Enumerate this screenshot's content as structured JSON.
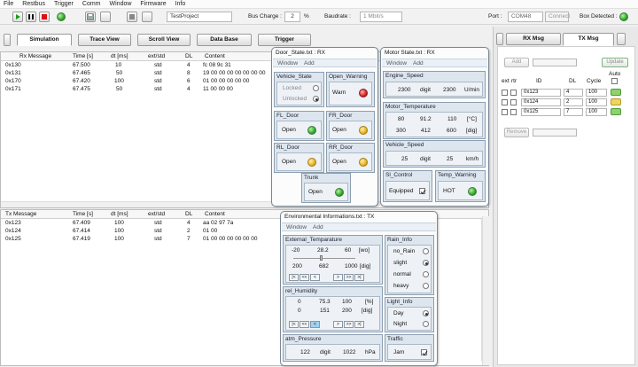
{
  "menu": [
    "File",
    "Restbus",
    "Trigger",
    "Comm",
    "Window",
    "Firmware",
    "Info"
  ],
  "toolbar": {
    "project": "TestProject",
    "bus_charge_label": "Bus Charge :",
    "bus_charge_value": "2",
    "bus_charge_unit": "%",
    "baudrate_label": "Baudrate :",
    "baudrate_value": "1 Mbit/s",
    "port_label": "Port :",
    "port_value": "COM48",
    "connect_label": "Connect",
    "box_detected_label": "Box Detected :"
  },
  "tabs": [
    "Simulation",
    "Trace View",
    "Scroll View",
    "Data Base",
    "Trigger"
  ],
  "rx_table": {
    "headers": [
      "Rx Message",
      "Time [s]",
      "dt [ms]",
      "ext/std",
      "DL",
      "Content"
    ],
    "rows": [
      [
        "0x130",
        "67.500",
        "10",
        "std",
        "4",
        "fc 08 9c 31"
      ],
      [
        "0x131",
        "67.465",
        "50",
        "std",
        "8",
        "19 00 00 00 00 00 00 00"
      ],
      [
        "0x170",
        "67.420",
        "100",
        "std",
        "6",
        "01 00 00 00 00 00"
      ],
      [
        "0x171",
        "67.475",
        "50",
        "std",
        "4",
        "11 00 00 00"
      ]
    ]
  },
  "tx_table": {
    "headers": [
      "Tx Message",
      "Time [s]",
      "dt [ms]",
      "ext/std",
      "DL",
      "Content"
    ],
    "rows": [
      [
        "0x123",
        "67.409",
        "100",
        "std",
        "4",
        "aa 02 97 7a"
      ],
      [
        "0x124",
        "67.414",
        "100",
        "std",
        "2",
        "01 00"
      ],
      [
        "0x125",
        "67.419",
        "100",
        "std",
        "7",
        "01 00 00 00 00 00 00"
      ]
    ]
  },
  "door_window": {
    "title": "Door_State.txt : RX",
    "menu": [
      "Window",
      "Add"
    ],
    "vehicle_state": {
      "title": "Vehicle_State",
      "opt1": "Locked",
      "opt2": "Unlocked"
    },
    "open_warning": {
      "title": "Open_Warning",
      "label": "Warn"
    },
    "fl": {
      "title": "FL_Door",
      "label": "Open"
    },
    "fr": {
      "title": "FR_Door",
      "label": "Open"
    },
    "rl": {
      "title": "RL_Door",
      "label": "Open"
    },
    "rr": {
      "title": "RR_Door",
      "label": "Open"
    },
    "trunk": {
      "title": "Trunk",
      "label": "Open"
    }
  },
  "motor_window": {
    "title": "Motor State.txt : RX",
    "menu": [
      "Window",
      "Add"
    ],
    "engine_speed": {
      "title": "Engine_Speed",
      "v1": "2300",
      "u1": "digit",
      "v2": "2300",
      "u2": "U/min"
    },
    "motor_temp": {
      "title": "Motor_Temperature",
      "r1": [
        "80",
        "91.2",
        "110",
        "[°C]"
      ],
      "r2": [
        "300",
        "412",
        "600",
        "[dig]"
      ]
    },
    "vehicle_speed": {
      "title": "Vehicle_Speed",
      "v1": "25",
      "u1": "digit",
      "v2": "25",
      "u2": "km/h"
    },
    "sl_control": {
      "title": "Sl_Control",
      "label": "Equipped"
    },
    "temp_warning": {
      "title": "Temp_Warning",
      "label": "HOT"
    }
  },
  "env_window": {
    "title": "Environmental Informations.txt : TX",
    "menu": [
      "Window",
      "Add"
    ],
    "ext_temp": {
      "title": "External_Temparature",
      "r1": [
        "-20",
        "28.2",
        "60",
        "[wo]"
      ],
      "r2": [
        "200",
        "682",
        "1000",
        "[dig]"
      ]
    },
    "humidity": {
      "title": "rel_Humidity",
      "r1": [
        "0",
        "75.3",
        "100",
        "[%]"
      ],
      "r2": [
        "0",
        "151",
        "200",
        "[dig]"
      ]
    },
    "pressure": {
      "title": "atm_Pressure",
      "v1": "122",
      "u1": "digit",
      "v2": "1022",
      "u2": "hPa"
    },
    "rain": {
      "title": "Rain_Info",
      "opts": [
        "no_Rain",
        "slight",
        "normal",
        "heavy"
      ],
      "selected": 1
    },
    "light": {
      "title": "Light_Info",
      "opts": [
        "Day",
        "Night"
      ],
      "selected": 0
    },
    "traffic": {
      "title": "Traffic",
      "label": "Jam"
    },
    "nav": [
      "|<",
      "<<",
      "<",
      ">",
      ">>",
      ">|"
    ]
  },
  "right_panel": {
    "tabs": [
      "RX Msg",
      "TX Msg"
    ],
    "add_label": "Add",
    "update_label": "Update",
    "remove_label": "Remove",
    "headers": [
      "ext",
      "rtr",
      "ID",
      "DL",
      "Cycle",
      "Auto"
    ],
    "rows": [
      {
        "id": "0x123",
        "dl": "4",
        "cycle": "100"
      },
      {
        "id": "0x124",
        "dl": "2",
        "cycle": "100"
      },
      {
        "id": "0x125",
        "dl": "7",
        "cycle": "100"
      }
    ]
  }
}
